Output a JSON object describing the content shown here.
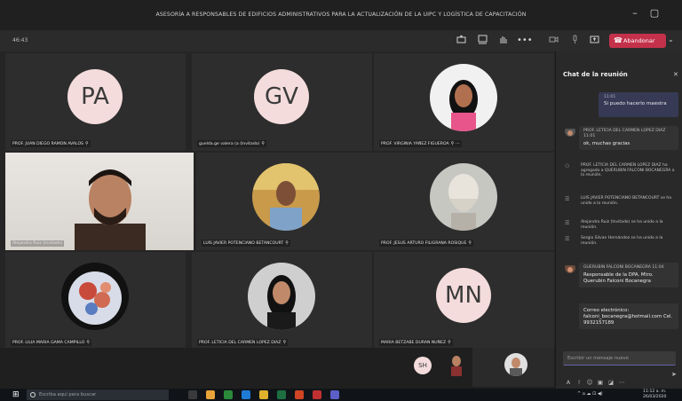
{
  "window": {
    "title": "ASESORÍA A RESPONSABLES DE EDIFICIOS ADMINISTRATIVOS PARA LA ACTUALIZACIÓN DE LA UIPC Y LOGÍSTICA DE CAPACITACIÓN",
    "minimize": "–",
    "maximize": "▢"
  },
  "toolbar": {
    "timer": "46:43",
    "more": "•••",
    "leave_label": "Abandonar",
    "colors": {
      "leave": "#c4314b"
    }
  },
  "participants": [
    {
      "initials": "PA",
      "name": "PROF. JUAN DIEGO RAMON AVALOS"
    },
    {
      "initials": "GV",
      "name": "guelda.ge valera (a (Invitado)"
    },
    {
      "initials": "",
      "name": "PROF. VIRGINIA YAÑEZ FIGUEROA"
    },
    {
      "initials": "",
      "name": "Alejandro Ruiz (Invitado)"
    },
    {
      "initials": "",
      "name": "LUIS JAVIER POTENCIANO BETANCOURT"
    },
    {
      "initials": "",
      "name": "PROF. JESUS ARTURO FILIGRANA ROSIQUE"
    },
    {
      "initials": "",
      "name": "PROF. LILIA MARIA GAMA CAMPILLO"
    },
    {
      "initials": "",
      "name": "PROF. LETICIA DEL CARMEN LOPEZ DIAZ"
    },
    {
      "initials": "MN",
      "name": "MARIA BETZABE DURAN NUÑEZ"
    }
  ],
  "mini_participants": [
    {
      "initials": "SH"
    }
  ],
  "chat": {
    "title": "Chat de la reunión",
    "my_message": {
      "time": "11:01",
      "text": "Si puedo hacerlo maestra"
    },
    "messages": [
      {
        "author": "PROF. LETICIA DEL CARMEN LOPEZ DIAZ 11:01",
        "text": "ok, muchas gracias"
      },
      {
        "author": "GUERUBIN FALCONI BOCANEGRA 11:04",
        "text": "Responsable de la DPA. Mtro. Querubin Falconi Bocanegra"
      },
      {
        "author": "",
        "text": "Correo electrónico: falconi_bocanegra@hotmail.com Cel. 9932157189"
      }
    ],
    "events": [
      "PROF. LETICIA DEL CARMEN LOPEZ DIAZ ha agregado a QUERUBIN FALCONI BOCANEGRA a la reunión.",
      "LUIS JAVIER POTENCIANO BETANCOURT se ha unido a la reunión.",
      "Alejandro Ruiz (Invitado) se ha unido a la reunión.",
      "Sergio Silvan Hernández se ha unido a la reunión."
    ],
    "input_placeholder": "Escribir un mensaje nuevo"
  },
  "taskbar": {
    "search_placeholder": "Escriba aquí para buscar",
    "time": "11:12 a. m.",
    "date": "26/03/2020"
  }
}
